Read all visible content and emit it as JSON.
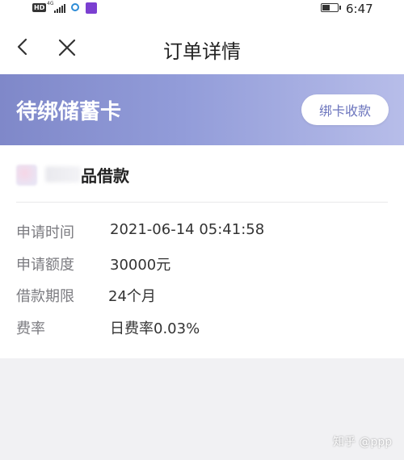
{
  "status_bar": {
    "hd_badge": "HD",
    "network": "4G",
    "time": "6:47",
    "battery_level": 0.5,
    "icons": [
      "hd-icon",
      "signal-icon",
      "app-ring-icon",
      "app-icon",
      "battery-icon"
    ]
  },
  "nav": {
    "title": "订单详情",
    "back_icon": "chevron-left-icon",
    "close_icon": "close-icon"
  },
  "banner": {
    "title": "待绑储蓄卡",
    "button_label": "绑卡收款",
    "gradient_start": "#7f88c9",
    "gradient_end": "#b7bde9"
  },
  "product": {
    "name": "品借款"
  },
  "details": [
    {
      "label": "申请时间",
      "value": "2021-06-14 05:41:58"
    },
    {
      "label": "申请额度",
      "value": "30000元"
    },
    {
      "label": "借款期限",
      "value": "24个月"
    },
    {
      "label": "费率",
      "value": "日费率0.03%"
    }
  ],
  "watermark": "知乎 @ppp"
}
